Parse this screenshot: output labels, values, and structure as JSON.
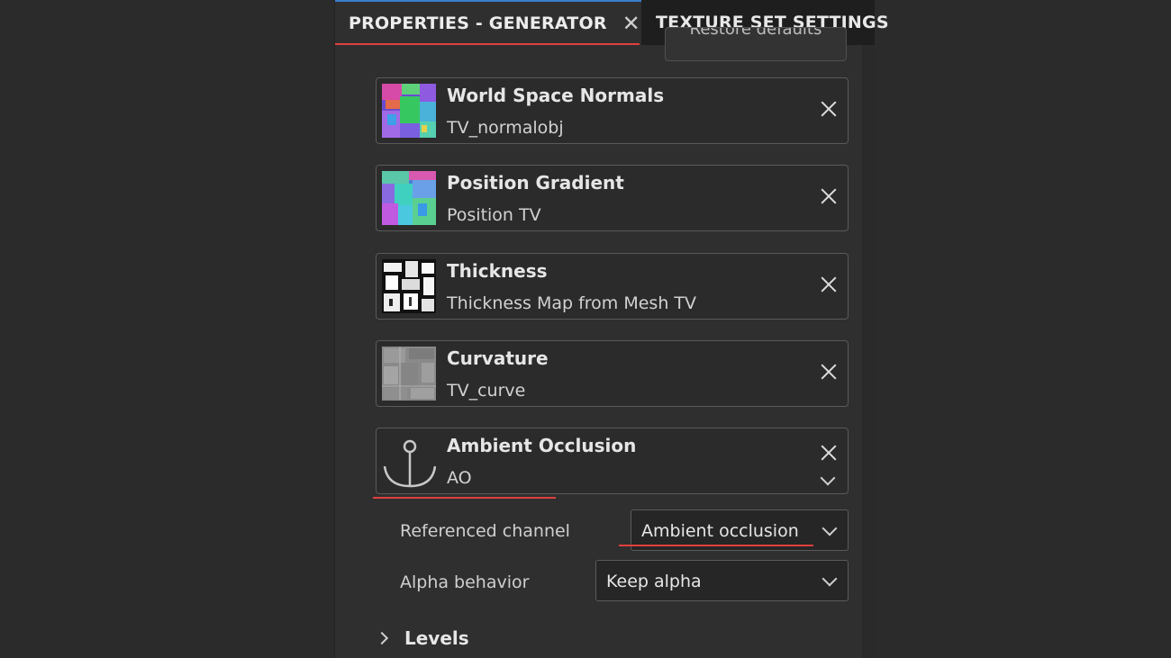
{
  "tabs": {
    "properties": {
      "label": "PROPERTIES - GENERATOR"
    },
    "texture_set": {
      "label": "TEXTURE SET SETTINGS"
    }
  },
  "restore_defaults": {
    "label": "Restore defaults"
  },
  "inputs": [
    {
      "title": "World Space Normals",
      "subtitle": "TV_normalobj",
      "icon": "normal-map-thumbnail"
    },
    {
      "title": "Position Gradient",
      "subtitle": "Position TV",
      "icon": "position-map-thumbnail"
    },
    {
      "title": "Thickness",
      "subtitle": "Thickness Map from Mesh TV",
      "icon": "thickness-map-thumbnail"
    },
    {
      "title": "Curvature",
      "subtitle": "TV_curve",
      "icon": "curvature-map-thumbnail"
    },
    {
      "title": "Ambient Occlusion",
      "subtitle": "AO",
      "icon": "anchor-icon"
    }
  ],
  "referenced_channel": {
    "label": "Referenced channel",
    "value": "Ambient occlusion"
  },
  "alpha_behavior": {
    "label": "Alpha behavior",
    "value": "Keep alpha"
  },
  "levels": {
    "label": "Levels"
  },
  "colors": {
    "accent_red": "#e0403e",
    "accent_blue": "#3a7ec9",
    "panel_bg": "#2f2f2f"
  }
}
